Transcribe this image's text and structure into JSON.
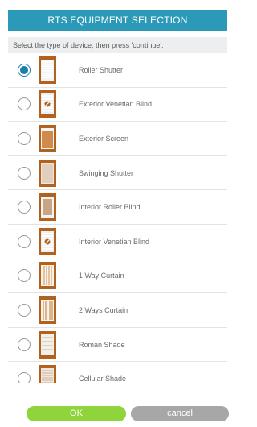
{
  "header": {
    "title": "RTS EQUIPMENT SELECTION"
  },
  "instruction": "Select the type of device, then press 'continue'.",
  "devices": [
    {
      "label": "Roller Shutter",
      "selected": true,
      "icon": "roller-shutter-icon"
    },
    {
      "label": "Exterior Venetian Blind",
      "selected": false,
      "icon": "exterior-venetian-blind-icon"
    },
    {
      "label": "Exterior Screen",
      "selected": false,
      "icon": "exterior-screen-icon"
    },
    {
      "label": "Swinging Shutter",
      "selected": false,
      "icon": "swinging-shutter-icon"
    },
    {
      "label": "Interior Roller Blind",
      "selected": false,
      "icon": "interior-roller-blind-icon"
    },
    {
      "label": "Interior Venetian Blind",
      "selected": false,
      "icon": "interior-venetian-blind-icon"
    },
    {
      "label": "1 Way Curtain",
      "selected": false,
      "icon": "one-way-curtain-icon"
    },
    {
      "label": "2 Ways Curtain",
      "selected": false,
      "icon": "two-ways-curtain-icon"
    },
    {
      "label": "Roman Shade",
      "selected": false,
      "icon": "roman-shade-icon"
    },
    {
      "label": "Cellular Shade",
      "selected": false,
      "icon": "cellular-shade-icon"
    }
  ],
  "buttons": {
    "ok": "OK",
    "cancel": "cancel"
  },
  "colors": {
    "header_bg": "#2a9ab8",
    "accent": "#1c7fa6",
    "ok_bg": "#8fd43a",
    "cancel_bg": "#a7a7a7",
    "thumb_frame": "#b0621e"
  }
}
